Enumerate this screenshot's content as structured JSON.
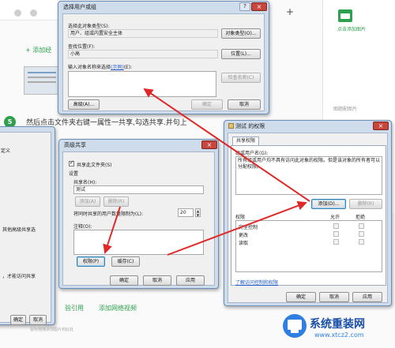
{
  "background": {
    "add_step_link": "+ 添加经",
    "right_rail": {
      "add_image": "点击添加图片",
      "greyed_button": "图题配图片"
    },
    "step_number": "5",
    "step_text": "然后点击文件夹右键一属性一共享,勾选共享.并句上",
    "bottom_links": [
      "验引用",
      "添加网络视频"
    ],
    "bottom_note": "鼠标拖拽添加图片到此处",
    "left_fragments": {
      "tab": "定义",
      "line1": "其他高级共享选",
      "line2": "，才能访问共享"
    },
    "plus_tab": "+"
  },
  "dialog_select_users": {
    "title": "选择用户或组",
    "object_type_label": "选择此对象类型(S):",
    "object_type_value": "用户、组或内置安全主体",
    "object_type_button": "对象类型(O)...",
    "location_label": "查找位置(F):",
    "location_value": "小高",
    "location_button": "位置(L)...",
    "names_label": "输入对象名称来选择",
    "names_example": "(示例)",
    "names_label_suffix": "(E):",
    "check_names_button": "检查名称(C)",
    "advanced_button": "高级(A)...",
    "ok_button": "确定",
    "cancel_button": "取消",
    "help_button": "?",
    "close_button": "×"
  },
  "dialog_advanced_share": {
    "title": "高级共享",
    "share_checkbox": "共享此文件夹(S)",
    "settings_group": "设置",
    "share_name_label": "共享名(H):",
    "share_name_value": "测试",
    "add_button": "添加(A)",
    "remove_button": "删除(R)",
    "limit_label": "将同时共享的用户数量限制为(L):",
    "limit_value": "20",
    "comment_label": "注释(O):",
    "permissions_button": "权限(P)",
    "cache_button": "缓存(C)",
    "ok_button": "确定",
    "cancel_button": "取消",
    "apply_button": "应用",
    "close_button": "×"
  },
  "dialog_permissions": {
    "title": "测试 的权限",
    "tab": "共享权限",
    "group_label": "组或用户名(G):",
    "group_info": "所有组或用户均不具有访问此对象的权限。但是该对象的所有者可以分配权限。",
    "add_button": "添加(D)...",
    "remove_button": "删除(R)",
    "col_permission": "权限",
    "col_allow": "允许",
    "col_deny": "拒绝",
    "permissions": [
      "完全控制",
      "更改",
      "读取"
    ],
    "help_link": "了解访问控制和权限",
    "ok_button": "确定",
    "cancel_button": "取消",
    "apply_button": "应用",
    "close_button": "×"
  },
  "dialog_left_partial": {
    "ok_button": "确定",
    "cancel_button": "取消"
  },
  "watermark": {
    "name": "系统重装网",
    "url": "www.xtcz2.com"
  },
  "colors": {
    "accent_green": "#2fa04e",
    "arrow_red": "#e02828",
    "link_blue": "#1a55c4"
  }
}
